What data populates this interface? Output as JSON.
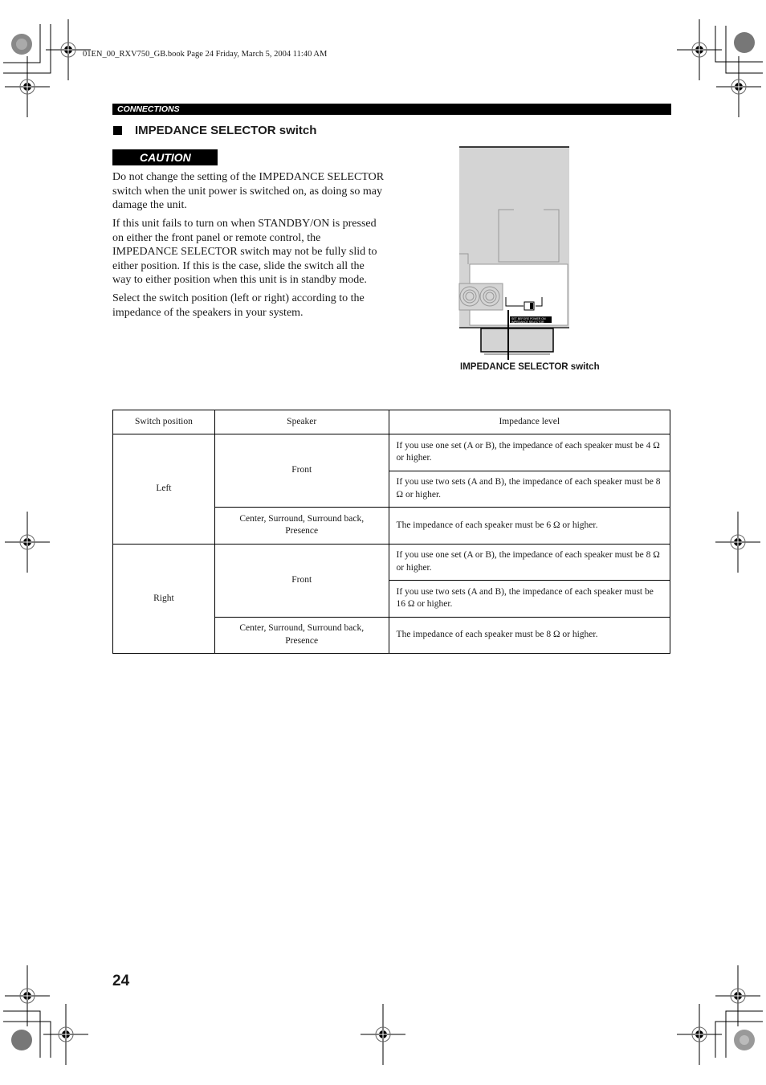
{
  "book_header": "01EN_00_RXV750_GB.book  Page 24  Friday, March 5, 2004  11:40 AM",
  "section_label": "CONNECTIONS",
  "heading": "IMPEDANCE SELECTOR switch",
  "caution_label": "CAUTION",
  "paragraphs": [
    "Do not change the setting of the IMPEDANCE SELECTOR switch when the unit power is switched on, as doing so may damage the unit.",
    "If this unit fails to turn on when STANDBY/ON is pressed on either the front panel or remote control, the IMPEDANCE SELECTOR switch may not be fully slid to either position. If this is the case, slide the switch all the way to either position when this unit is in standby mode.",
    "Select the switch position (left or right) according to the impedance of the speakers in your system."
  ],
  "figure": {
    "caption": "IMPEDANCE SELECTOR switch",
    "panel_label_line1": "SET BEFORE POWER ON",
    "panel_label_line2": "IMPEDANCE SELECTOR"
  },
  "table": {
    "headers": [
      "Switch position",
      "Speaker",
      "Impedance level"
    ],
    "groups": [
      {
        "position": "Left",
        "front_label": "Front",
        "front_rows": [
          "If you use one set (A or B), the impedance of each speaker must be 4 Ω or higher.",
          "If you use two sets (A and B), the impedance of each speaker must be 8 Ω or higher."
        ],
        "other_label": "Center, Surround, Surround back, Presence",
        "other_row": "The impedance of each speaker must be 6 Ω or higher."
      },
      {
        "position": "Right",
        "front_label": "Front",
        "front_rows": [
          "If you use one set (A or B), the impedance of each speaker must be 8 Ω or higher.",
          "If you use two sets (A and B), the impedance of each speaker must be 16 Ω or higher."
        ],
        "other_label": "Center, Surround, Surround back, Presence",
        "other_row": "The impedance of each speaker must be 8 Ω or higher."
      }
    ]
  },
  "page_number": "24"
}
